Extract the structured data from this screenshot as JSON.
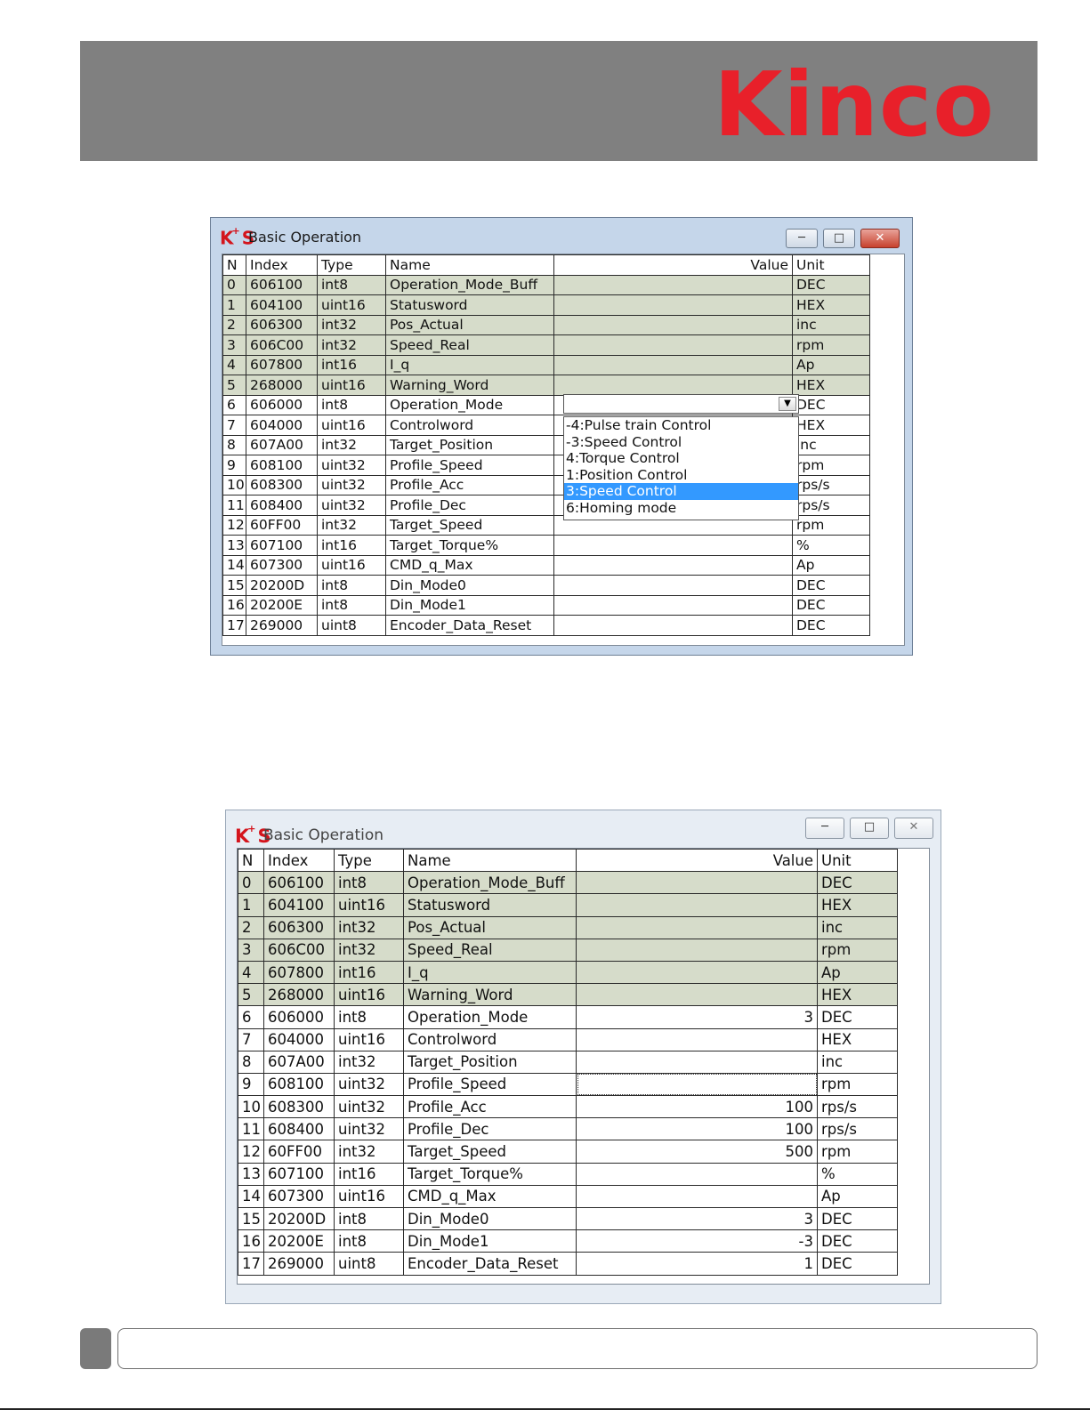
{
  "header": {
    "logo_text": "Kinco",
    "brand_color": "#e8202a",
    "banner_color": "#808080"
  },
  "window1": {
    "title": "Basic Operation",
    "icon": "KS",
    "columns": [
      "N",
      "Index",
      "Type",
      "Name",
      "Value",
      "Unit"
    ],
    "rows": [
      {
        "n": "0",
        "index": "606100",
        "type": "int8",
        "name": "Operation_Mode_Buff",
        "value": "",
        "unit": "DEC",
        "shaded": true
      },
      {
        "n": "1",
        "index": "604100",
        "type": "uint16",
        "name": "Statusword",
        "value": "",
        "unit": "HEX",
        "shaded": true
      },
      {
        "n": "2",
        "index": "606300",
        "type": "int32",
        "name": "Pos_Actual",
        "value": "",
        "unit": "inc",
        "shaded": true
      },
      {
        "n": "3",
        "index": "606C00",
        "type": "int32",
        "name": "Speed_Real",
        "value": "",
        "unit": "rpm",
        "shaded": true
      },
      {
        "n": "4",
        "index": "607800",
        "type": "int16",
        "name": "I_q",
        "value": "",
        "unit": "Ap",
        "shaded": true
      },
      {
        "n": "5",
        "index": "268000",
        "type": "uint16",
        "name": "Warning_Word",
        "value": "",
        "unit": "HEX",
        "shaded": true
      },
      {
        "n": "6",
        "index": "606000",
        "type": "int8",
        "name": "Operation_Mode",
        "value": "",
        "unit": "DEC",
        "shaded": false
      },
      {
        "n": "7",
        "index": "604000",
        "type": "uint16",
        "name": "Controlword",
        "value": "",
        "unit": "HEX",
        "shaded": false
      },
      {
        "n": "8",
        "index": "607A00",
        "type": "int32",
        "name": "Target_Position",
        "value": "",
        "unit": "inc",
        "shaded": false
      },
      {
        "n": "9",
        "index": "608100",
        "type": "uint32",
        "name": "Profile_Speed",
        "value": "",
        "unit": "rpm",
        "shaded": false
      },
      {
        "n": "10",
        "index": "608300",
        "type": "uint32",
        "name": "Profile_Acc",
        "value": "",
        "unit": "rps/s",
        "shaded": false
      },
      {
        "n": "11",
        "index": "608400",
        "type": "uint32",
        "name": "Profile_Dec",
        "value": "",
        "unit": "rps/s",
        "shaded": false
      },
      {
        "n": "12",
        "index": "60FF00",
        "type": "int32",
        "name": "Target_Speed",
        "value": "",
        "unit": "rpm",
        "shaded": false
      },
      {
        "n": "13",
        "index": "607100",
        "type": "int16",
        "name": "Target_Torque%",
        "value": "",
        "unit": "%",
        "shaded": false
      },
      {
        "n": "14",
        "index": "607300",
        "type": "uint16",
        "name": "CMD_q_Max",
        "value": "",
        "unit": "Ap",
        "shaded": false
      },
      {
        "n": "15",
        "index": "20200D",
        "type": "int8",
        "name": "Din_Mode0",
        "value": "",
        "unit": "DEC",
        "shaded": false
      },
      {
        "n": "16",
        "index": "20200E",
        "type": "int8",
        "name": "Din_Mode1",
        "value": "",
        "unit": "DEC",
        "shaded": false
      },
      {
        "n": "17",
        "index": "269000",
        "type": "uint8",
        "name": "Encoder_Data_Reset",
        "value": "",
        "unit": "DEC",
        "shaded": false
      }
    ],
    "dropdown": {
      "selected_value": "",
      "options": [
        "-4:Pulse train Control",
        "-3:Speed Control",
        "4:Torque Control",
        "1:Position Control",
        "3:Speed Control",
        "6:Homing mode"
      ],
      "highlighted_index": 4
    }
  },
  "window2": {
    "title": "Basic Operation",
    "icon": "KS",
    "columns": [
      "N",
      "Index",
      "Type",
      "Name",
      "Value",
      "Unit"
    ],
    "rows": [
      {
        "n": "0",
        "index": "606100",
        "type": "int8",
        "name": "Operation_Mode_Buff",
        "value": "",
        "unit": "DEC",
        "shaded": true
      },
      {
        "n": "1",
        "index": "604100",
        "type": "uint16",
        "name": "Statusword",
        "value": "",
        "unit": "HEX",
        "shaded": true
      },
      {
        "n": "2",
        "index": "606300",
        "type": "int32",
        "name": "Pos_Actual",
        "value": "",
        "unit": "inc",
        "shaded": true
      },
      {
        "n": "3",
        "index": "606C00",
        "type": "int32",
        "name": "Speed_Real",
        "value": "",
        "unit": "rpm",
        "shaded": true
      },
      {
        "n": "4",
        "index": "607800",
        "type": "int16",
        "name": "I_q",
        "value": "",
        "unit": "Ap",
        "shaded": true
      },
      {
        "n": "5",
        "index": "268000",
        "type": "uint16",
        "name": "Warning_Word",
        "value": "",
        "unit": "HEX",
        "shaded": true
      },
      {
        "n": "6",
        "index": "606000",
        "type": "int8",
        "name": "Operation_Mode",
        "value": "3",
        "unit": "DEC",
        "shaded": false
      },
      {
        "n": "7",
        "index": "604000",
        "type": "uint16",
        "name": "Controlword",
        "value": "",
        "unit": "HEX",
        "shaded": false
      },
      {
        "n": "8",
        "index": "607A00",
        "type": "int32",
        "name": "Target_Position",
        "value": "",
        "unit": "inc",
        "shaded": false
      },
      {
        "n": "9",
        "index": "608100",
        "type": "uint32",
        "name": "Profile_Speed",
        "value": "",
        "unit": "rpm",
        "shaded": false,
        "focused": true
      },
      {
        "n": "10",
        "index": "608300",
        "type": "uint32",
        "name": "Profile_Acc",
        "value": "100",
        "unit": "rps/s",
        "shaded": false
      },
      {
        "n": "11",
        "index": "608400",
        "type": "uint32",
        "name": "Profile_Dec",
        "value": "100",
        "unit": "rps/s",
        "shaded": false
      },
      {
        "n": "12",
        "index": "60FF00",
        "type": "int32",
        "name": "Target_Speed",
        "value": "500",
        "unit": "rpm",
        "shaded": false
      },
      {
        "n": "13",
        "index": "607100",
        "type": "int16",
        "name": "Target_Torque%",
        "value": "",
        "unit": "%",
        "shaded": false
      },
      {
        "n": "14",
        "index": "607300",
        "type": "uint16",
        "name": "CMD_q_Max",
        "value": "",
        "unit": "Ap",
        "shaded": false
      },
      {
        "n": "15",
        "index": "20200D",
        "type": "int8",
        "name": "Din_Mode0",
        "value": "3",
        "unit": "DEC",
        "shaded": false
      },
      {
        "n": "16",
        "index": "20200E",
        "type": "int8",
        "name": "Din_Mode1",
        "value": "-3",
        "unit": "DEC",
        "shaded": false
      },
      {
        "n": "17",
        "index": "269000",
        "type": "uint8",
        "name": "Encoder_Data_Reset",
        "value": "1",
        "unit": "DEC",
        "shaded": false
      }
    ]
  },
  "icons": {
    "minimize": "minimize-icon",
    "maximize": "maximize-icon",
    "close": "close-icon",
    "dropdown_arrow": "chevron-down-icon"
  },
  "colors": {
    "shaded_row": "#d6dcca",
    "selection": "#3399ff"
  }
}
